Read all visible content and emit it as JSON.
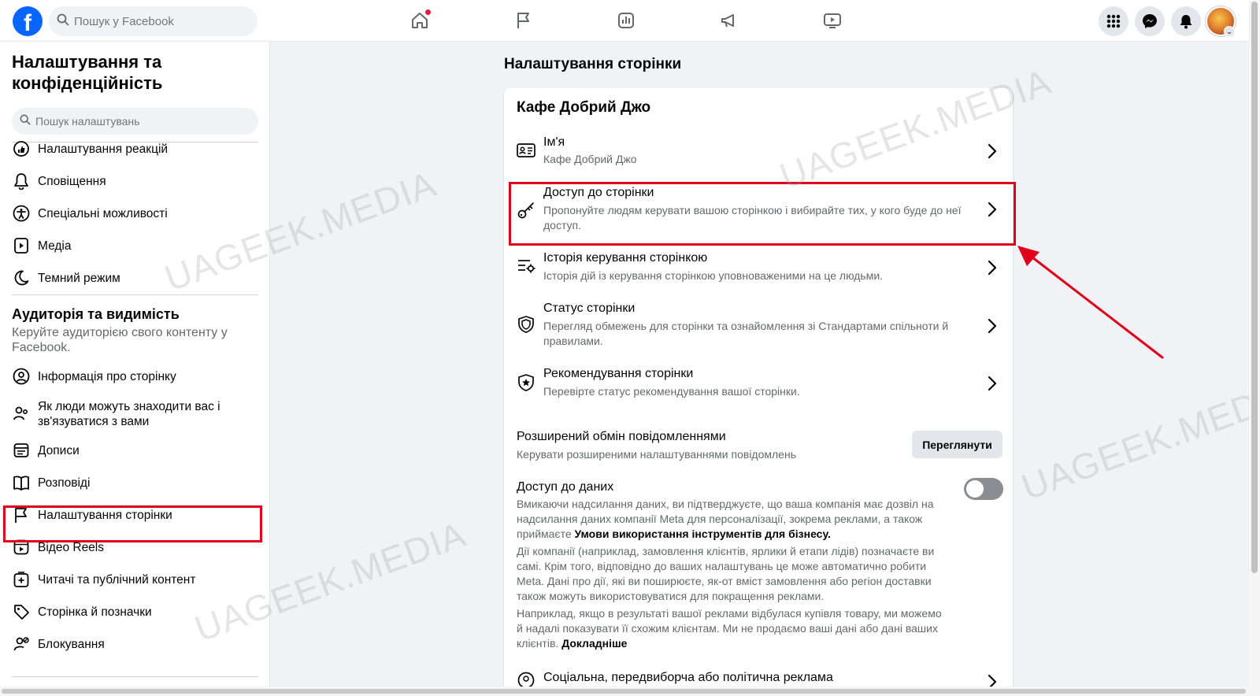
{
  "topbar": {
    "logo": "f",
    "search_placeholder": "Пошук у Facebook",
    "nav_icons": [
      "home-icon",
      "flag-icon",
      "insights-icon",
      "megaphone-icon",
      "video-icon"
    ],
    "right_icons": [
      "apps-grid-icon",
      "messenger-icon",
      "bell-icon"
    ]
  },
  "sidebar": {
    "title": "Налаштування та конфіденційність",
    "search_placeholder": "Пошук налаштувань",
    "items_top": [
      {
        "label": "Налаштування реакцій",
        "icon": "reactions-icon"
      },
      {
        "label": "Сповіщення",
        "icon": "bell-icon"
      },
      {
        "label": "Спеціальні можливості",
        "icon": "accessibility-icon"
      },
      {
        "label": "Медіа",
        "icon": "media-icon"
      },
      {
        "label": "Темний режим",
        "icon": "moon-icon"
      }
    ],
    "section_title": "Аудиторія та видимість",
    "section_desc": "Керуйте аудиторією свого контенту у Facebook.",
    "items_bottom": [
      {
        "label": "Інформація про сторінку",
        "icon": "profile-icon"
      },
      {
        "label": "Як люди можуть знаходити вас і зв'язуватися з вами",
        "icon": "people-icon"
      },
      {
        "label": "Дописи",
        "icon": "posts-icon"
      },
      {
        "label": "Розповіді",
        "icon": "stories-icon"
      },
      {
        "label": "Налаштування сторінки",
        "icon": "flag-icon"
      },
      {
        "label": "Відео Reels",
        "icon": "reels-icon"
      },
      {
        "label": "Читачі та публічний контент",
        "icon": "followers-icon"
      },
      {
        "label": "Сторінка й позначки",
        "icon": "tag-icon"
      },
      {
        "label": "Блокування",
        "icon": "block-user-icon"
      }
    ]
  },
  "main": {
    "title": "Налаштування сторінки",
    "card_title": "Кафе Добрий Джо",
    "rows": [
      {
        "title": "Ім'я",
        "desc": "Кафе Добрий Джо",
        "icon": "id-card-icon"
      },
      {
        "title": "Доступ до сторінки",
        "desc": "Пропонуйте людям керувати вашою сторінкою і вибирайте тих, у кого буде до неї доступ.",
        "icon": "key-icon"
      },
      {
        "title": "Історія керування сторінкою",
        "desc": "Історія дій із керування сторінкою уповноваженими на це людьми.",
        "icon": "history-settings-icon"
      },
      {
        "title": "Статус сторінки",
        "desc": "Перегляд обмежень для сторінки та ознайомлення зі Стандартами спільноти й правилами.",
        "icon": "shield-icon"
      },
      {
        "title": "Рекомендування сторінки",
        "desc": "Перевірте статус рекомендування вашої сторінки.",
        "icon": "star-shield-icon"
      }
    ],
    "messaging": {
      "title": "Розширений обмін повідомленнями",
      "desc": "Керувати розширеними налаштуваннями повідомлень",
      "button": "Переглянути"
    },
    "data_access": {
      "title": "Доступ до даних",
      "toggle_on": false,
      "p1_text": "Вмикаючи надсилання даних, ви підтверджуєте, що ваша компанія має дозвіл на надсилання даних компанії Meta для персоналізації, зокрема реклами, а також приймаєте ",
      "p1_bold": "Умови використання інструментів для бізнесу.",
      "p2": "Дії компанії (наприклад, замовлення клієнтів, ярлики й етапи лідів) позначаєте ви самі. Крім того, відповідно до ваших налаштувань це може автоматично робити Meta. Дані про дії, які ви поширюєте, як-от вміст замовлення або регіон доставки також можуть використовуватися для покращення реклами.",
      "p3_text": "Наприклад, якщо в результаті вашої реклами відбулася купівля товару, ми можемо й надалі показувати її схожим клієнтам. Ми не продаємо ваші дані або дані ваших клієнтів. ",
      "p3_bold": "Докладніше"
    },
    "last_row_title": "Соціальна, передвиборча або політична реклама"
  },
  "watermark": "UAGEEK.MEDIA",
  "colors": {
    "brand": "#0866ff",
    "highlight": "#e0001b",
    "page_bg": "#f0f2f5"
  }
}
